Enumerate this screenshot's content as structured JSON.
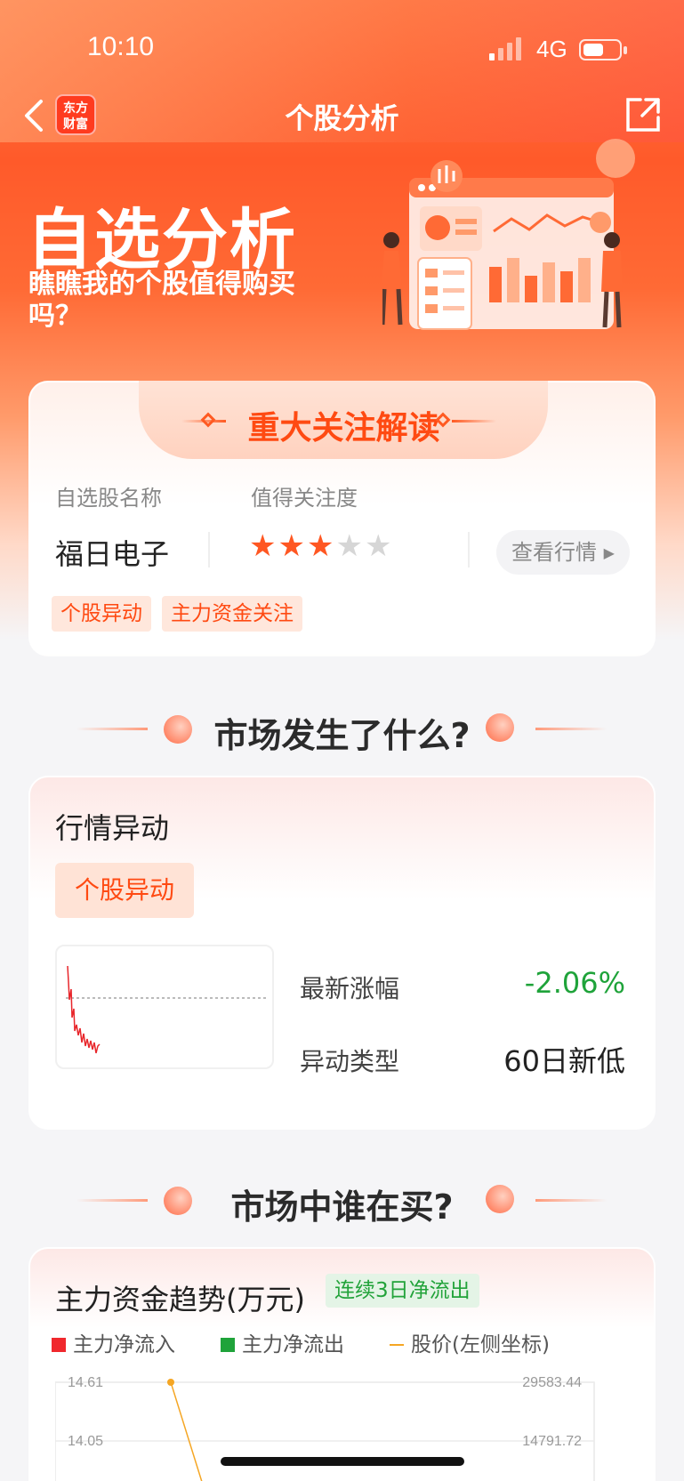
{
  "status_bar": {
    "time": "10:10",
    "network": "4G"
  },
  "nav": {
    "logo_line1": "东方",
    "logo_line2": "财富",
    "title": "个股分析"
  },
  "banner": {
    "title": "自选分析",
    "subtitle": "瞧瞧我的个股值得购买吗？"
  },
  "focus_card": {
    "title": "重大关注解读",
    "name_label": "自选股名称",
    "attention_label": "值得关注度",
    "stock_name": "福日电子",
    "rating": 3,
    "rating_max": 5,
    "view_button": "查看行情",
    "tags": [
      "个股异动",
      "主力资金关注"
    ]
  },
  "section1": {
    "title": "市场发生了什么?"
  },
  "anomaly_card": {
    "title": "行情异动",
    "pill": "个股异动",
    "latest_change_label": "最新涨幅",
    "latest_change_value": "-2.06%",
    "anomaly_type_label": "异动类型",
    "anomaly_type_value": "60日新低"
  },
  "section2": {
    "title": "市场中谁在买?"
  },
  "fund_card": {
    "title": "主力资金趋势(万元)",
    "badge": "连续3日净流出",
    "legend": [
      {
        "label": "主力净流入",
        "color": "#f0282d"
      },
      {
        "label": "主力净流出",
        "color": "#1fa33a"
      },
      {
        "label": "股价(左侧坐标)",
        "color": "#f5a623"
      }
    ]
  },
  "chart_data": {
    "type": "bar",
    "left_axis_ticks": [
      "14.61",
      "14.05"
    ],
    "right_axis_ticks": [
      "29583.44",
      "14791.72"
    ],
    "series": [
      {
        "name": "股价(左侧坐标)",
        "values": [
          14.61
        ]
      }
    ]
  },
  "colors": {
    "accent": "#ff4a12",
    "up": "#f0282d",
    "down": "#1fa33a"
  }
}
